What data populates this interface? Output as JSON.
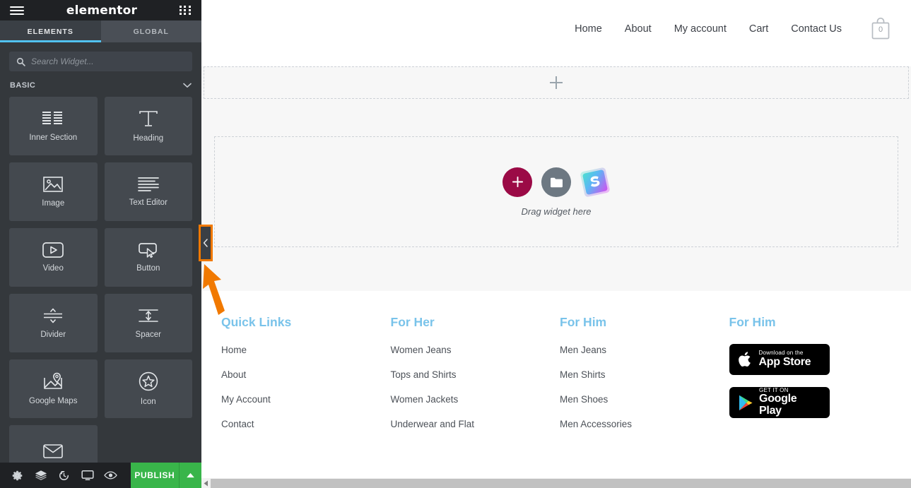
{
  "panel": {
    "logo": "elementor",
    "menu_icon": "hamburger-icon",
    "apps_icon": "grid-apps-icon",
    "tabs": [
      {
        "label": "ELEMENTS",
        "active": true
      },
      {
        "label": "GLOBAL",
        "active": false
      }
    ],
    "search": {
      "placeholder": "Search Widget...",
      "value": "",
      "icon": "search-icon"
    },
    "category": {
      "title": "BASIC",
      "chevron": "chevron-down-icon"
    },
    "widgets": [
      {
        "label": "Inner Section",
        "icon": "columns-icon"
      },
      {
        "label": "Heading",
        "icon": "heading-t-icon"
      },
      {
        "label": "Image",
        "icon": "image-icon"
      },
      {
        "label": "Text Editor",
        "icon": "text-lines-icon"
      },
      {
        "label": "Video",
        "icon": "video-play-icon"
      },
      {
        "label": "Button",
        "icon": "button-cursor-icon"
      },
      {
        "label": "Divider",
        "icon": "divider-icon"
      },
      {
        "label": "Spacer",
        "icon": "spacer-icon"
      },
      {
        "label": "Google Maps",
        "icon": "map-pin-icon"
      },
      {
        "label": "Icon",
        "icon": "star-circle-icon"
      },
      {
        "label": "",
        "icon": "envelope-icon"
      }
    ],
    "collapse_handle": {
      "icon": "chevron-left-icon",
      "highlight_color": "#f17900"
    },
    "bottom_bar": {
      "icons": [
        {
          "name": "settings-gear-icon"
        },
        {
          "name": "navigator-layers-icon"
        },
        {
          "name": "history-revisions-icon"
        },
        {
          "name": "responsive-mode-icon"
        },
        {
          "name": "preview-eye-icon"
        }
      ],
      "publish_label": "PUBLISH",
      "publish_caret_icon": "caret-up-icon",
      "publish_color": "#39b54a"
    }
  },
  "preview": {
    "header": {
      "nav": [
        {
          "label": "Home"
        },
        {
          "label": "About"
        },
        {
          "label": "My account"
        },
        {
          "label": "Cart"
        },
        {
          "label": "Contact Us"
        }
      ],
      "cart": {
        "icon": "shopping-bag-icon",
        "count": "0"
      }
    },
    "builder": {
      "add_section_icon": "plus-icon",
      "drop_zone": {
        "add_icon": "plus-icon",
        "folder_icon": "folder-template-icon",
        "brand_icon": "sunrise-s-logo-icon",
        "hint": "Drag widget here"
      }
    },
    "footer": {
      "accent_color": "#79c3ea",
      "columns": [
        {
          "title": "Quick Links",
          "links": [
            "Home",
            "About",
            "My Account",
            "Contact"
          ]
        },
        {
          "title": "For Her",
          "links": [
            "Women Jeans",
            "Tops and Shirts",
            "Women Jackets",
            "Underwear and Flat"
          ]
        },
        {
          "title": "For Him",
          "links": [
            "Men Jeans",
            "Men Shirts",
            "Men Shoes",
            "Men Accessories"
          ]
        },
        {
          "title": "For Him",
          "badges": [
            {
              "small": "Download on the",
              "big": "App Store",
              "icon": "apple-logo-icon"
            },
            {
              "small": "GET IT ON",
              "big": "Google Play",
              "icon": "google-play-icon"
            }
          ]
        }
      ]
    },
    "scrollbar": {
      "left_arrow_icon": "scroll-left-arrow-icon"
    }
  }
}
